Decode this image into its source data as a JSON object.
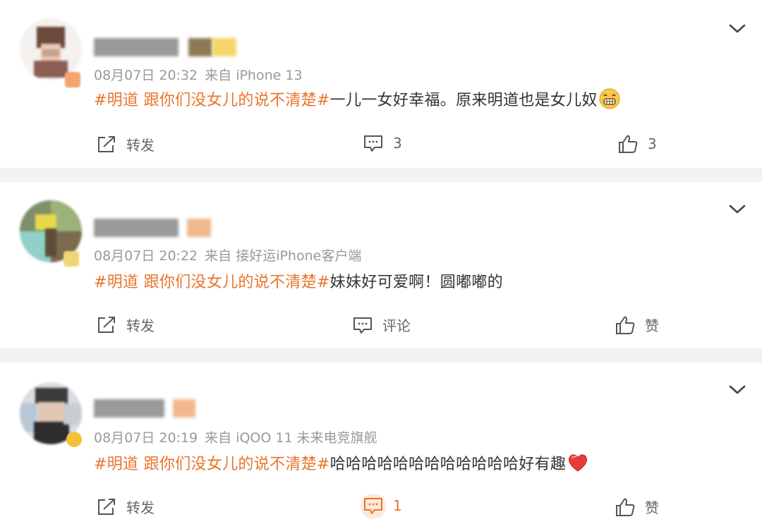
{
  "posts": [
    {
      "meta_time": "08月07日 20:32",
      "meta_source": "来自 iPhone 13",
      "topic": "#明道 跟你们没女儿的说不清楚#",
      "body": "一儿一女好幸福。原来明道也是女儿奴",
      "emoji": "grin-emoji",
      "repost_label": "转发",
      "comment_label": "3",
      "like_label": "3"
    },
    {
      "meta_time": "08月07日 20:22",
      "meta_source": "来自 接好运iPhone客户端",
      "topic": "#明道 跟你们没女儿的说不清楚#",
      "body": "妹妹好可爱啊！圆嘟嘟的",
      "repost_label": "转发",
      "comment_label": "评论",
      "like_label": "赞"
    },
    {
      "meta_time": "08月07日 20:19",
      "meta_source": "来自 iQOO 11 未来电竞旗舰",
      "topic": "#明道 跟你们没女儿的说不清楚#",
      "body": "哈哈哈哈哈哈哈哈哈哈哈哈好有趣",
      "emoji": "heart-emoji",
      "repost_label": "转发",
      "comment_label": "1",
      "like_label": "赞"
    }
  ],
  "colors": {
    "topic": "#e8742c",
    "meta": "#999999",
    "separator": "#f2f2f2",
    "active_comment": "#e8742c"
  }
}
